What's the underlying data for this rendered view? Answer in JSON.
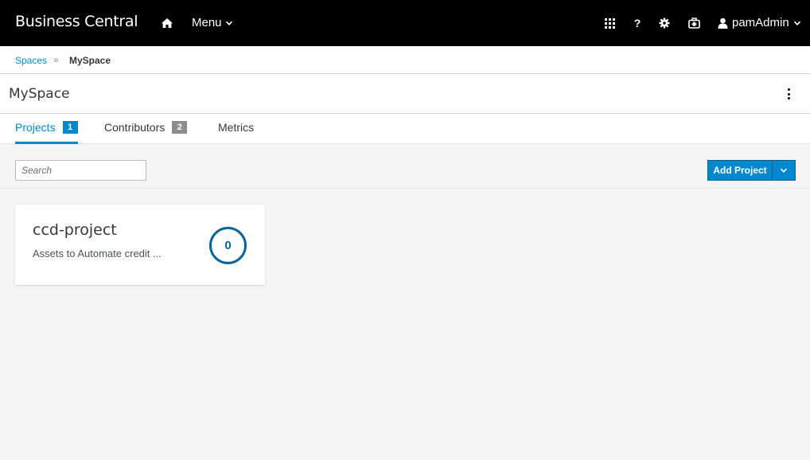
{
  "navbar": {
    "brand": "Business Central",
    "menu_label": "Menu",
    "user_label": "pamAdmin",
    "icons": [
      "home-icon",
      "apps-grid-icon",
      "help-icon",
      "settings-icon",
      "briefcase-icon",
      "user-icon",
      "chevron-down-icon"
    ]
  },
  "breadcrumb": {
    "parent": "Spaces",
    "separator": "»",
    "current": "MySpace"
  },
  "page": {
    "title": "MySpace"
  },
  "tabs": [
    {
      "label": "Projects",
      "count": "1",
      "active": true
    },
    {
      "label": "Contributors",
      "count": "2",
      "active": false
    },
    {
      "label": "Metrics",
      "count": null,
      "active": false
    }
  ],
  "toolbar": {
    "search_placeholder": "Search",
    "add_project_label": "Add Project"
  },
  "projects": [
    {
      "name": "ccd-project",
      "description": "Assets to Automate credit ...",
      "count": "0"
    }
  ],
  "colors": {
    "navbar_bg": "#000000",
    "accent": "#0088ce",
    "page_bg": "#f5f5f5"
  }
}
